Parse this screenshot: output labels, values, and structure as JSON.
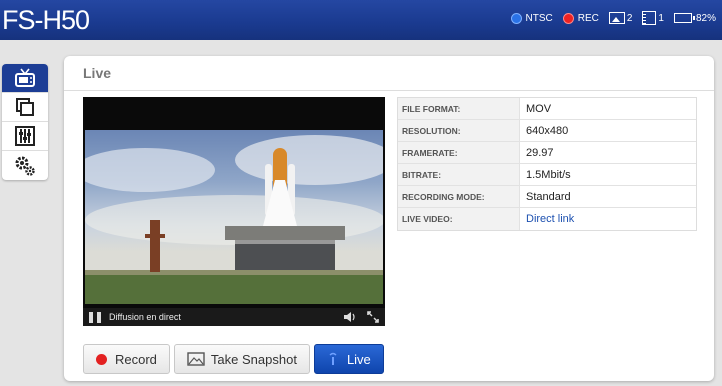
{
  "header": {
    "brand": "FS-H50",
    "status": {
      "ntsc_label": "NTSC",
      "rec_label": "REC",
      "pictures_count": "2",
      "videos_count": "1",
      "battery_percent": "82%",
      "battery_level": 0.82
    }
  },
  "sidebar": {
    "items": [
      {
        "icon": "tv-icon",
        "active": true
      },
      {
        "icon": "copy-icon",
        "active": false
      },
      {
        "icon": "equalizer-icon",
        "active": false
      },
      {
        "icon": "gears-icon",
        "active": false
      }
    ]
  },
  "panel": {
    "title": "Live"
  },
  "video": {
    "caption": "Diffusion en direct"
  },
  "info": {
    "rows": [
      {
        "label": "FILE FORMAT:",
        "value": "MOV"
      },
      {
        "label": "RESOLUTION:",
        "value": "640x480"
      },
      {
        "label": "FRAMERATE:",
        "value": "29.97"
      },
      {
        "label": "BITRATE:",
        "value": "1.5Mbit/s"
      },
      {
        "label": "RECORDING MODE:",
        "value": "Standard"
      },
      {
        "label": "LIVE VIDEO:",
        "value": "Direct link"
      }
    ]
  },
  "actions": {
    "record_label": "Record",
    "snapshot_label": "Take Snapshot",
    "live_label": "Live"
  },
  "colors": {
    "header_blue": "#1a3a8f",
    "live_button": "#1a55c4",
    "record_red": "#e32121"
  }
}
